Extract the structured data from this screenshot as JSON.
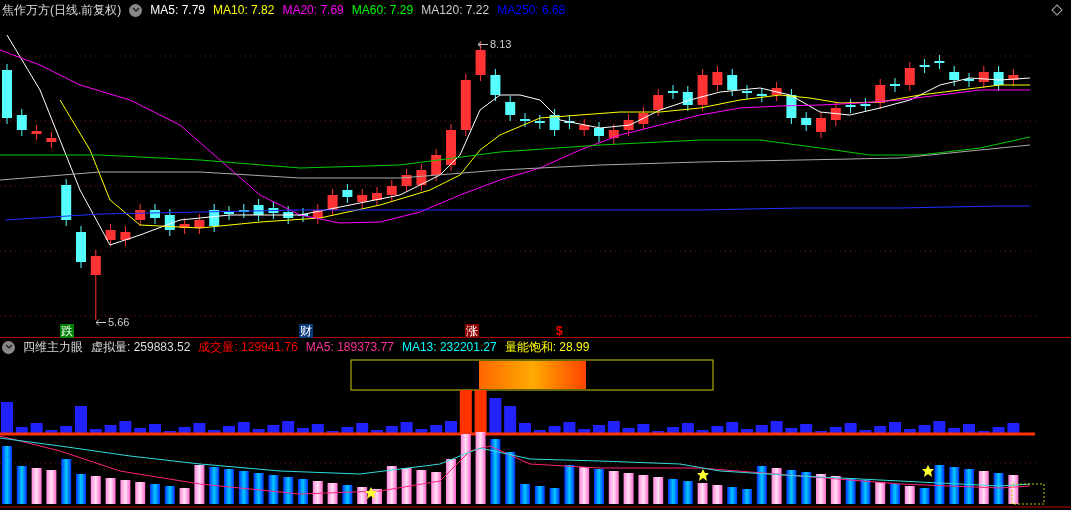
{
  "chart_title": "焦作万方(日线.前复权)",
  "ma_labels": [
    {
      "text": "MA5: 7.79",
      "color": "#ffffff"
    },
    {
      "text": "MA10: 7.82",
      "color": "#ffff00"
    },
    {
      "text": "MA20: 7.69",
      "color": "#ff00ff"
    },
    {
      "text": "MA60: 7.29",
      "color": "#00ff00"
    },
    {
      "text": "MA120: 7.22",
      "color": "#cccccc"
    },
    {
      "text": "MA250: 6.68",
      "color": "#0000ff"
    }
  ],
  "price_annotations": [
    {
      "text": "8.13"
    },
    {
      "text": "5.66"
    }
  ],
  "signal_markers": [
    {
      "text": "跌",
      "kind": "badge",
      "color": "#008000"
    },
    {
      "text": "财",
      "kind": "badge",
      "color": "#0a3a7a"
    },
    {
      "text": "涨",
      "kind": "badge",
      "color": "#8b0000"
    },
    {
      "text": "$",
      "kind": "glyph",
      "color": "#ff0000"
    }
  ],
  "indicator": {
    "name": "四维主力眼",
    "values": [
      {
        "text": "虚拟量: 259883.52",
        "color": "#dddddd"
      },
      {
        "text": "成交量: 129941.76",
        "color": "#ff0000"
      },
      {
        "text": "MA5: 189373.77",
        "color": "#ff3399"
      },
      {
        "text": "MA13: 232201.27",
        "color": "#00ffff"
      },
      {
        "text": "量能饱和: 28.99",
        "color": "#ffff00"
      }
    ]
  }
}
